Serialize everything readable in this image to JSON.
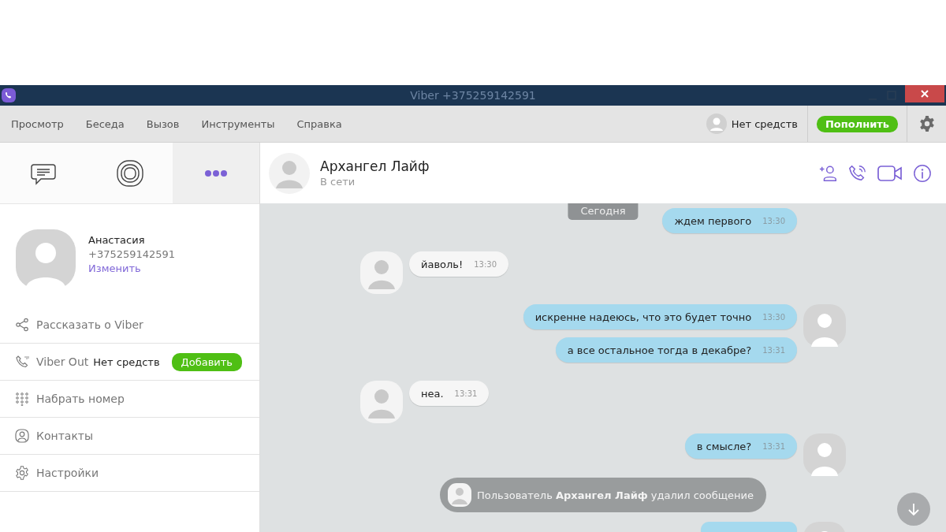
{
  "window": {
    "title": "Viber +375259142591"
  },
  "menu": [
    "Просмотр",
    "Беседа",
    "Вызов",
    "Инструменты",
    "Справка"
  ],
  "account": {
    "balance": "Нет средств",
    "topup_button": "Пополнить"
  },
  "side_tabs": [
    {
      "kind": "chats",
      "selected": false
    },
    {
      "kind": "stories",
      "selected": false
    },
    {
      "kind": "more",
      "selected": true
    }
  ],
  "profile": {
    "name": "Анастасия",
    "phone": "+375259142591",
    "edit_link": "Изменить"
  },
  "side_menu": [
    {
      "kind": "share",
      "label": "Рассказать о Viber"
    },
    {
      "kind": "viber_out",
      "label": "Viber Out",
      "balance": "Нет средств",
      "button": "Добавить"
    },
    {
      "kind": "dial",
      "label": "Набрать номер"
    },
    {
      "kind": "contacts",
      "label": "Контакты"
    },
    {
      "kind": "settings",
      "label": "Настройки"
    }
  ],
  "chat": {
    "name": "Архангел Лайф",
    "status": "В сети",
    "date_separator": "Сегодня",
    "messages": [
      {
        "kind": "outgoing",
        "text": "ждем первого",
        "time": "13:30",
        "avatar": false
      },
      {
        "kind": "incoming",
        "text": "йаволь!",
        "time": "13:30",
        "avatar": true
      },
      {
        "kind": "outgoing",
        "text": "искренне надеюсь, что это будет точно",
        "time": "13:30",
        "avatar": true
      },
      {
        "kind": "outgoing",
        "text": "а все остальное тогда в декабре?",
        "time": "13:31",
        "avatar": false
      },
      {
        "kind": "incoming",
        "text": "неа.",
        "time": "13:31",
        "avatar": true
      },
      {
        "kind": "outgoing",
        "text": "в смысле?",
        "time": "13:31",
        "avatar": true
      },
      {
        "kind": "system",
        "text": "Пользователь **Архангел Лайф** удалил сообщение",
        "avatar": true
      },
      {
        "kind": "outgoing_cut",
        "avatar": true
      }
    ]
  }
}
